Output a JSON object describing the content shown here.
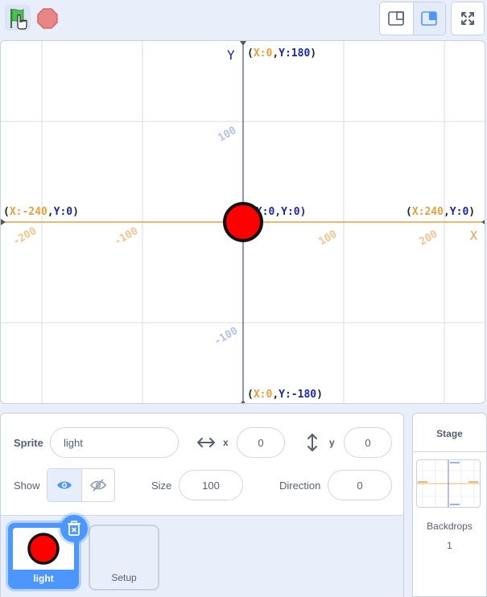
{
  "toolbar": {
    "green_flag_icon": "green-flag-icon",
    "stop_icon": "stop-sign-icon",
    "small_stage_icon": "small-stage-icon",
    "normal_stage_icon": "normal-stage-icon",
    "fullscreen_icon": "fullscreen-icon"
  },
  "stage": {
    "y_axis_label": "Y",
    "x_axis_label": "X",
    "top_coord": {
      "prefix": "(",
      "xk": "X:",
      "xv": "0",
      "sep": ",",
      "yk": "Y:",
      "yv": "180",
      "suffix": ")"
    },
    "bottom_coord": {
      "prefix": "(",
      "xk": "X:",
      "xv": "0",
      "sep": ",",
      "yk": "Y:",
      "yv": "-180",
      "suffix": ")"
    },
    "left_coord": {
      "prefix": "(",
      "xk": "X:",
      "xv": "-240",
      "sep": ",",
      "yk": "Y:",
      "yv": "0",
      "suffix": ")"
    },
    "right_coord": {
      "prefix": "(",
      "xk": "X:",
      "xv": "240",
      "sep": ",",
      "yk": "Y:",
      "yv": "0",
      "suffix": ")"
    },
    "center_coord": "(X:0,Y:0)",
    "x_ticks": [
      "-200",
      "-100",
      "100",
      "200"
    ],
    "y_ticks": [
      "100",
      "-100"
    ],
    "sprite_color": "#ff0000"
  },
  "sprite_info": {
    "sprite_label": "Sprite",
    "sprite_name": "light",
    "x_label": "x",
    "x_value": "0",
    "y_label": "y",
    "y_value": "0",
    "show_label": "Show",
    "size_label": "Size",
    "size_value": "100",
    "direction_label": "Direction",
    "direction_value": "0"
  },
  "sprites": [
    {
      "name": "light",
      "selected": true
    },
    {
      "name": "Setup",
      "selected": false
    }
  ],
  "stage_selector": {
    "title": "Stage",
    "backdrops_label": "Backdrops",
    "backdrops_count": "1"
  },
  "colors": {
    "accent": "#4c97ff",
    "x_axis": "#e6a03b",
    "y_axis": "#1a24b5"
  }
}
